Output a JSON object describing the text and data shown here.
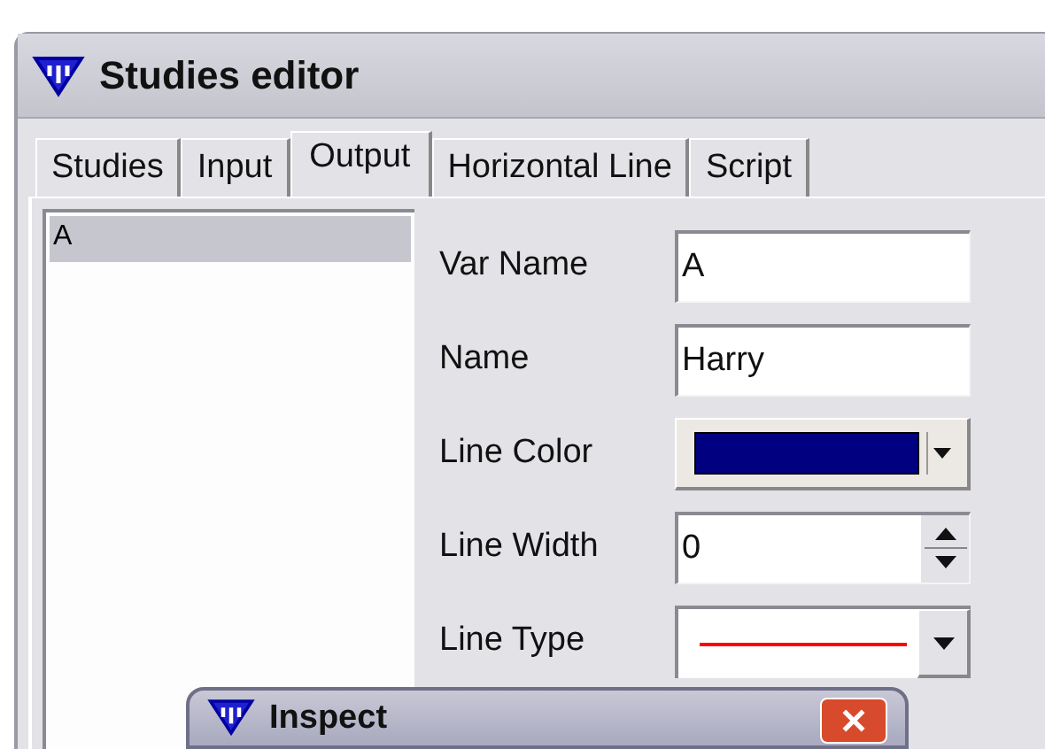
{
  "window": {
    "title": "Studies editor"
  },
  "tabs": [
    {
      "label": "Studies",
      "selected": false
    },
    {
      "label": "Input",
      "selected": false
    },
    {
      "label": "Output",
      "selected": true
    },
    {
      "label": "Horizontal Line",
      "selected": false
    },
    {
      "label": "Script",
      "selected": false
    }
  ],
  "list": {
    "items": [
      {
        "label": "A",
        "selected": true
      }
    ]
  },
  "fields": [
    {
      "kind": "text",
      "label": "Var Name",
      "value": "A"
    },
    {
      "kind": "text",
      "label": "Name",
      "value": "Harry"
    },
    {
      "kind": "color",
      "label": "Line Color",
      "color": "#000080"
    },
    {
      "kind": "spin",
      "label": "Line Width",
      "value": "0"
    },
    {
      "kind": "linetype",
      "label": "Line Type",
      "color": "#ff0000"
    }
  ],
  "dialog": {
    "title": "Inspect"
  }
}
